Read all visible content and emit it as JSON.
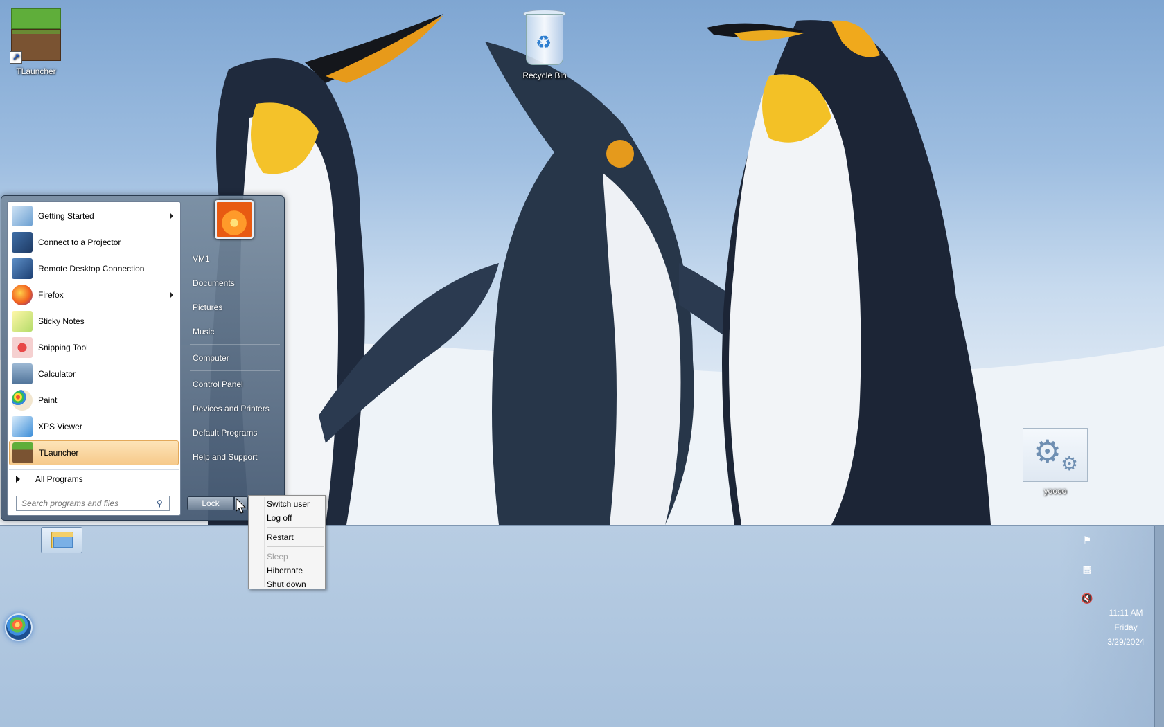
{
  "desktop": {
    "icons": {
      "tlauncher": "TLauncher",
      "recycle_bin": "Recycle Bin",
      "yoooo": "yoooo"
    }
  },
  "start_menu": {
    "programs": [
      {
        "label": "Getting Started",
        "icon": "getting-started-icon",
        "has_submenu": true
      },
      {
        "label": "Connect to a Projector",
        "icon": "projector-icon",
        "has_submenu": false
      },
      {
        "label": "Remote Desktop Connection",
        "icon": "remote-desktop-icon",
        "has_submenu": false
      },
      {
        "label": "Firefox",
        "icon": "firefox-icon",
        "has_submenu": true
      },
      {
        "label": "Sticky Notes",
        "icon": "sticky-notes-icon",
        "has_submenu": false
      },
      {
        "label": "Snipping Tool",
        "icon": "snipping-tool-icon",
        "has_submenu": false
      },
      {
        "label": "Calculator",
        "icon": "calculator-icon",
        "has_submenu": false
      },
      {
        "label": "Paint",
        "icon": "paint-icon",
        "has_submenu": false
      },
      {
        "label": "XPS Viewer",
        "icon": "xps-viewer-icon",
        "has_submenu": false
      },
      {
        "label": "TLauncher",
        "icon": "tlauncher-icon",
        "has_submenu": false,
        "selected": true
      }
    ],
    "all_programs": "All Programs",
    "search_placeholder": "Search programs and files",
    "right_links": {
      "vm1": "VM1",
      "documents": "Documents",
      "pictures": "Pictures",
      "music": "Music",
      "computer": "Computer",
      "control_panel": "Control Panel",
      "devices_printers": "Devices and Printers",
      "default_programs": "Default Programs",
      "help_support": "Help and Support"
    },
    "lock_label": "Lock"
  },
  "power_menu": {
    "switch_user": "Switch user",
    "log_off": "Log off",
    "restart": "Restart",
    "sleep": "Sleep",
    "hibernate": "Hibernate",
    "shut_down": "Shut down"
  },
  "taskbar": {
    "clock": {
      "time": "11:11 AM",
      "day": "Friday",
      "date": "3/29/2024"
    }
  },
  "colors": {
    "selection": "#f6c98a",
    "taskbar": "#a8c1dc",
    "start_menu_panel": "#5a6f88"
  }
}
